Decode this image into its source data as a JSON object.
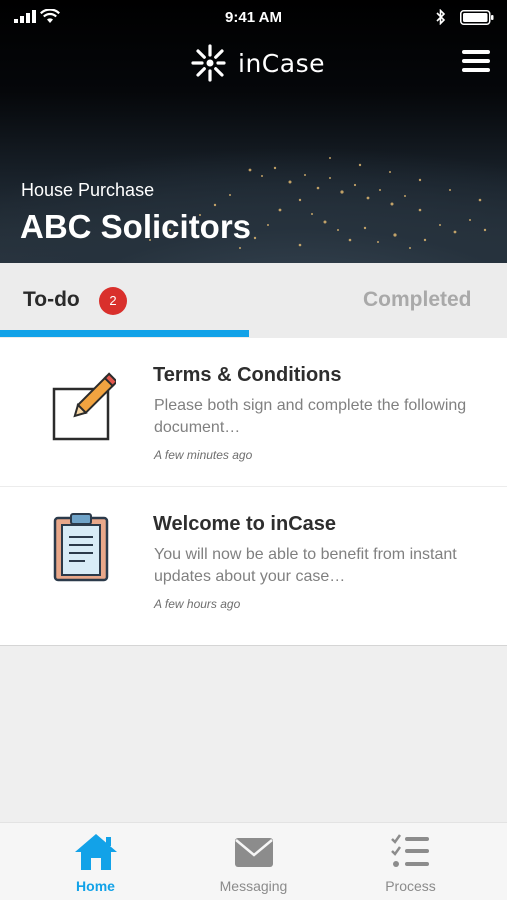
{
  "status_bar": {
    "time": "9:41 AM"
  },
  "header": {
    "brand": "inCase",
    "case_type": "House Purchase",
    "firm_name": "ABC Solicitors"
  },
  "tabs": {
    "todo_label": "To-do",
    "todo_count": "2",
    "completed_label": "Completed",
    "active": "To-do"
  },
  "tasks": [
    {
      "title": "Terms & Conditions",
      "description": "Please both sign and complete the following document…",
      "time": "A few minutes ago",
      "icon": "edit-document-icon"
    },
    {
      "title": "Welcome to inCase",
      "description": "You will now be able to benefit from instant updates about your case…",
      "time": "A few hours ago",
      "icon": "clipboard-icon"
    }
  ],
  "bottom_nav": [
    {
      "label": "Home",
      "icon": "home-icon",
      "active": true
    },
    {
      "label": "Messaging",
      "icon": "envelope-icon",
      "active": false
    },
    {
      "label": "Process",
      "icon": "checklist-icon",
      "active": false
    }
  ],
  "colors": {
    "accent": "#12a2e8",
    "badge": "#d9302c",
    "header_bg": "#0a0e14"
  }
}
